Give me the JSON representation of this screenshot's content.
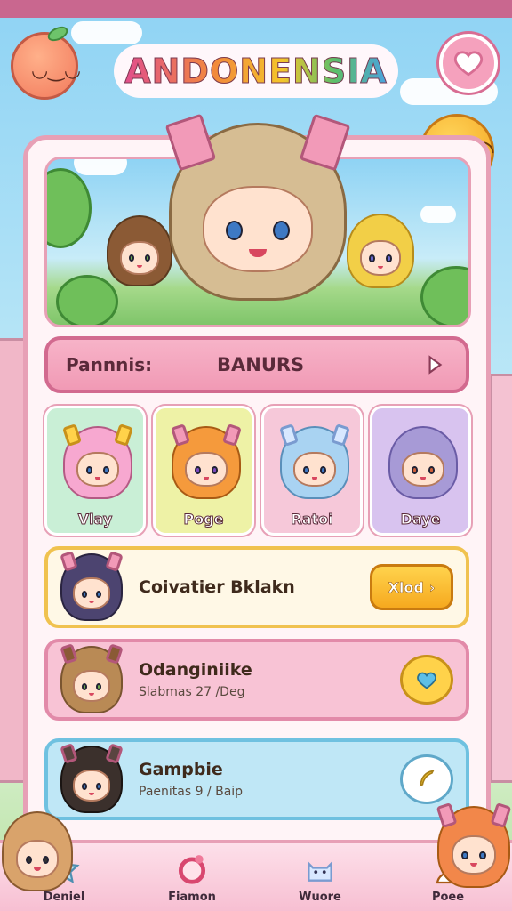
{
  "app": {
    "title": "ANDONENSIA"
  },
  "banner": {
    "label": "Pannnis:",
    "value": "BANURS"
  },
  "characters": [
    {
      "name": "Vlay",
      "hair": "#f7a8d0",
      "bg": "#c9efd6"
    },
    {
      "name": "Poge",
      "hair": "#f59a3c",
      "bg": "#eef2a6"
    },
    {
      "name": "Ratoi",
      "hair": "#a9d3f2",
      "bg": "#f6c8d9"
    },
    {
      "name": "Daye",
      "hair": "#a79ad6",
      "bg": "#d8c3ef"
    }
  ],
  "list": [
    {
      "title": "Coivatier Bklakn",
      "subtitle": "",
      "action_label": "Xlod",
      "hair": "#4c4470"
    },
    {
      "title": "Odanginiike",
      "subtitle": "Slabmas 27 /Deg",
      "hair": "#b98a55"
    },
    {
      "title": "Gampbie",
      "subtitle": "Paenitas 9 / Baip",
      "hair": "#3b302c"
    }
  ],
  "nav": [
    {
      "label": "Deniel",
      "icon": "star-icon"
    },
    {
      "label": "Fiamon",
      "icon": "ring-icon"
    },
    {
      "label": "Wuore",
      "icon": "cat-icon"
    },
    {
      "label": "Poee",
      "icon": "profile-icon"
    }
  ],
  "colors": {
    "accent": "#e7a0b6",
    "panel": "#fff4f7",
    "gold": "#f6a91f"
  }
}
